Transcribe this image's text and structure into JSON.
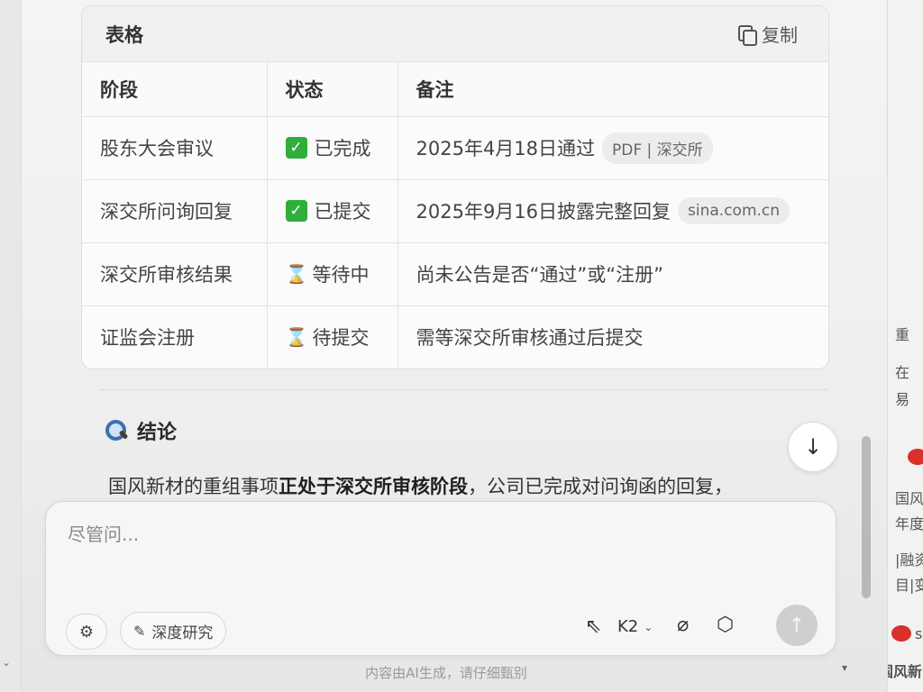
{
  "table_card": {
    "title": "表格",
    "copy_label": "复制",
    "headers": [
      "阶段",
      "状态",
      "备注"
    ],
    "rows": [
      {
        "stage": "股东大会审议",
        "status_icon": "check-icon",
        "status": "已完成",
        "note": "2025年4月18日通过",
        "source": "PDF | 深交所"
      },
      {
        "stage": "深交所问询回复",
        "status_icon": "check-icon",
        "status": "已提交",
        "note": "2025年9月16日披露完整回复",
        "source": "sina.com.cn"
      },
      {
        "stage": "深交所审核结果",
        "status_icon": "hourglass-icon",
        "status": "等待中",
        "note": "尚未公告是否“通过”或“注册”",
        "source": ""
      },
      {
        "stage": "证监会注册",
        "status_icon": "hourglass-icon",
        "status": "待提交",
        "note": "需等深交所审核通过后提交",
        "source": ""
      }
    ]
  },
  "conclusion": {
    "icon": "magnifier-icon",
    "title": "结论",
    "text_before": "国风新材的重组事项",
    "text_bold": "正处于深交所审核阶段",
    "text_after": "，公司已完成对问询函的回复，"
  },
  "input": {
    "placeholder": "尽管问...",
    "deep_research_label": "深度研究",
    "model_label": "K2"
  },
  "footer": {
    "disclaimer": "内容由AI生成，请仔细甄别"
  },
  "right_panel": {
    "snippets": [
      "重",
      "在",
      "易",
      "国风",
      "年度",
      "|融资",
      "目|变",
      "s",
      "国风新"
    ]
  }
}
